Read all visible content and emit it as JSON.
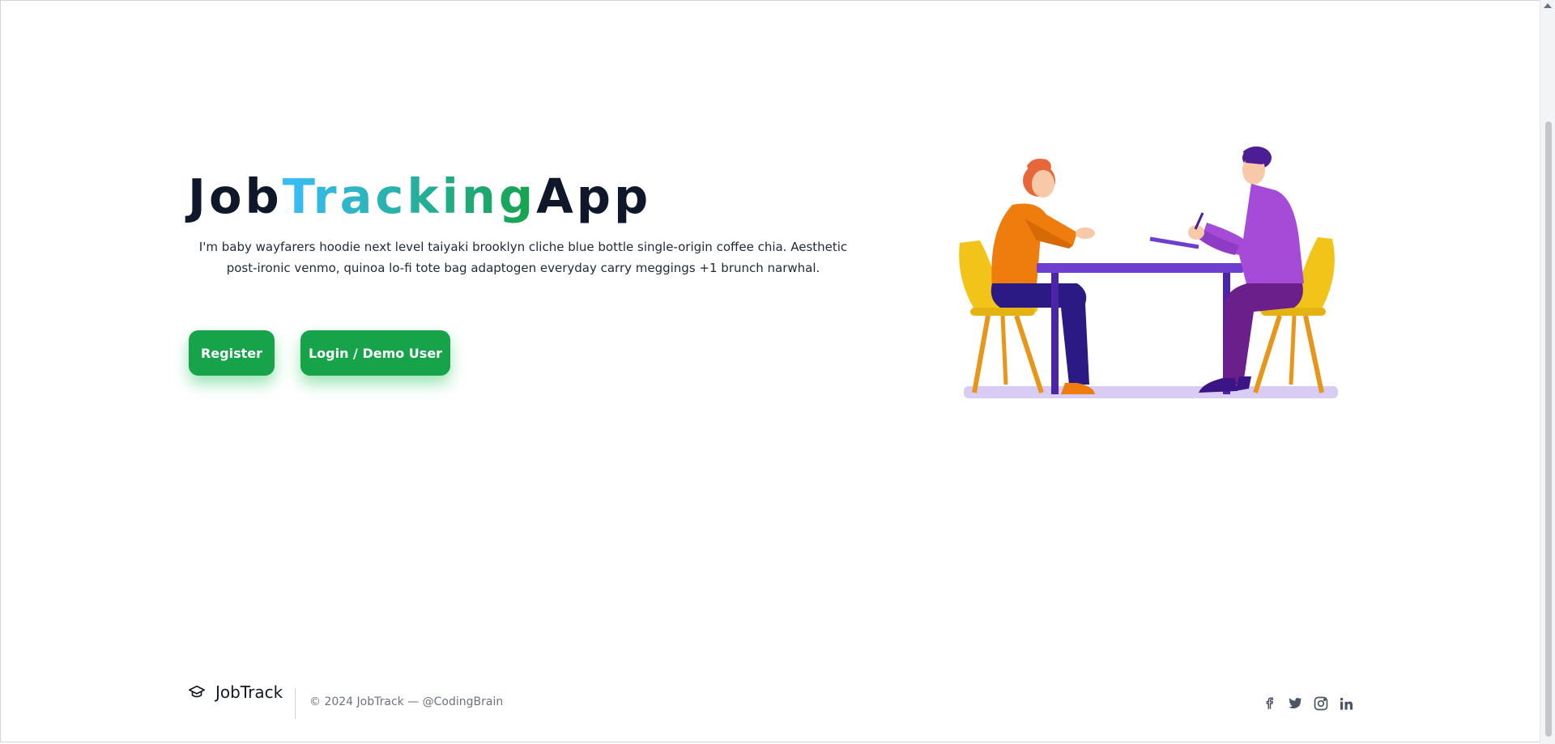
{
  "hero": {
    "title_part1": "Job",
    "title_part2": "Tracking",
    "title_part3": "App",
    "description": "I'm baby wayfarers hoodie next level taiyaki brooklyn cliche blue bottle single-origin coffee chia. Aesthetic post-ironic venmo, quinoa lo-fi tote bag adaptogen everyday carry meggings +1 brunch narwhal.",
    "register_label": "Register",
    "login_label": "Login / Demo User"
  },
  "illustration": {
    "icon": "job-interview-illustration"
  },
  "footer": {
    "brand": "JobTrack",
    "brand_icon": "graduation-cap-icon",
    "copyright": "© 2024 JobTrack — @CodingBrain",
    "social": [
      "facebook-icon",
      "twitter-icon",
      "instagram-icon",
      "linkedin-icon"
    ]
  },
  "colors": {
    "button": "#16a34a",
    "title_dark": "#0f172a",
    "gradient_start": "#38bdf8",
    "gradient_end": "#16a34a"
  }
}
